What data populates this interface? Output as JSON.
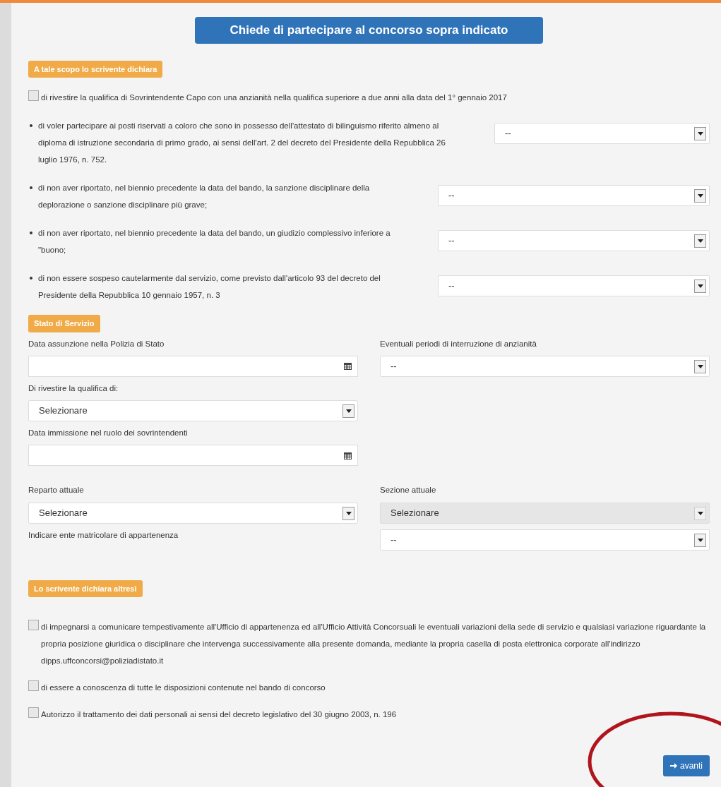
{
  "title": "Chiede di partecipare al concorso sopra indicato",
  "declarations": {
    "heading": "A tale scopo lo scrivente dichiara",
    "checkbox": {
      "label": "di rivestire la qualifica di Sovrintendente Capo con una anzianità nella qualifica superiore a due anni alla data del 1° gennaio 2017",
      "checked": false
    },
    "items": [
      {
        "text": "di voler partecipare ai posti riservati a coloro che sono in possesso dell'attestato di bilinguismo riferito almeno al diploma di istruzione secondaria di primo grado, ai sensi dell'art. 2 del decreto del Presidente della Repubblica 26 luglio 1976, n. 752.",
        "value": "--"
      },
      {
        "text": "di non aver riportato, nel biennio precedente la data del bando, la sanzione disciplinare della deplorazione o sanzione disciplinare più grave;",
        "value": "--"
      },
      {
        "text": "di non aver riportato, nel biennio precedente la data del bando, un giudizio complessivo inferiore a \"buono;",
        "value": "--"
      },
      {
        "text": "di non essere sospeso cautelarmente dal servizio, come previsto dall'articolo 93 del decreto del Presidente della Repubblica 10 gennaio 1957, n. 3",
        "value": "--"
      }
    ]
  },
  "service": {
    "heading": "Stato di Servizio",
    "rows": [
      [
        {
          "kind": "date",
          "label": "Data assunzione nella Polizia di Stato"
        },
        {
          "kind": "select",
          "label": "Eventuali periodi di interruzione di anzianità",
          "value": "--",
          "disabled": false
        }
      ],
      [
        {
          "kind": "select",
          "label": "Di rivestire la qualifica di:",
          "value": "Selezionare",
          "disabled": false
        }
      ],
      [
        {
          "kind": "date",
          "label": "Data immissione nel ruolo dei sovrintendenti"
        }
      ],
      [
        {
          "kind": "select",
          "label": "Reparto attuale",
          "value": "Selezionare",
          "disabled": false
        },
        {
          "kind": "select",
          "label": "Sezione attuale",
          "value": "Selezionare",
          "disabled": true
        }
      ]
    ],
    "ente": {
      "label": "Indicare ente matricolare di appartenenza",
      "value": "--"
    }
  },
  "further": {
    "heading": "Lo scrivente dichiara altresì",
    "checkboxes": [
      {
        "label": "di impegnarsi a comunicare tempestivamente all'Ufficio di appartenenza ed all'Ufficio Attività Concorsuali le eventuali variazioni della sede di servizio e qualsiasi variazione riguardante la propria posizione giuridica o disciplinare che intervenga successivamente alla presente domanda, mediante la propria casella di posta elettronica corporate all'indirizzo dipps.uffconcorsi@poliziadistato.it",
        "checked": false
      },
      {
        "label": "di essere a conoscenza di tutte le disposizioni contenute nel bando di concorso",
        "checked": false
      },
      {
        "label": "Autorizzo il trattamento dei dati personali ai sensi del decreto legislativo del 30 giugno 2003, n. 196",
        "checked": false
      }
    ]
  },
  "next_button": "avanti"
}
